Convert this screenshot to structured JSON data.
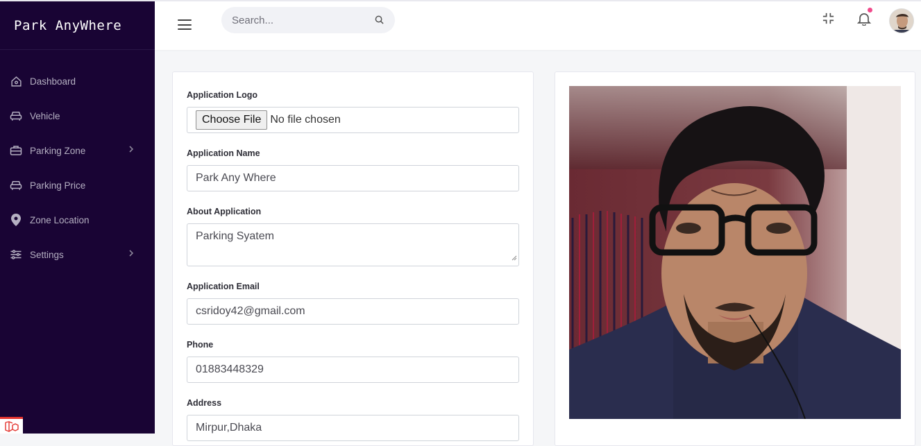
{
  "app": {
    "brand": "Park AnyWhere"
  },
  "sidebar": {
    "items": [
      {
        "label": "Dashboard",
        "icon": "home-icon"
      },
      {
        "label": "Vehicle",
        "icon": "car-icon"
      },
      {
        "label": "Parking Zone",
        "icon": "briefcase-icon",
        "has_submenu": true
      },
      {
        "label": "Parking Price",
        "icon": "car-icon"
      },
      {
        "label": "Zone Location",
        "icon": "map-pin-icon"
      },
      {
        "label": "Settings",
        "icon": "sliders-icon",
        "has_submenu": true
      }
    ]
  },
  "topbar": {
    "search_placeholder": "Search...",
    "notification_dot_color": "#f04a8b"
  },
  "form": {
    "logo_label": "Application Logo",
    "choose_file_label": "Choose File",
    "no_file_text": "No file chosen",
    "name_label": "Application Name",
    "name_value": "Park Any Where",
    "about_label": "About Application",
    "about_value": "Parking Syatem",
    "email_label": "Application Email",
    "email_value": "csridoy42@gmail.com",
    "phone_label": "Phone",
    "phone_value": "01883448329",
    "address_label": "Address",
    "address_value": "Mirpur,Dhaka"
  },
  "colors": {
    "sidebar_bg": "#190434",
    "accent_laravel": "#e3342f"
  }
}
